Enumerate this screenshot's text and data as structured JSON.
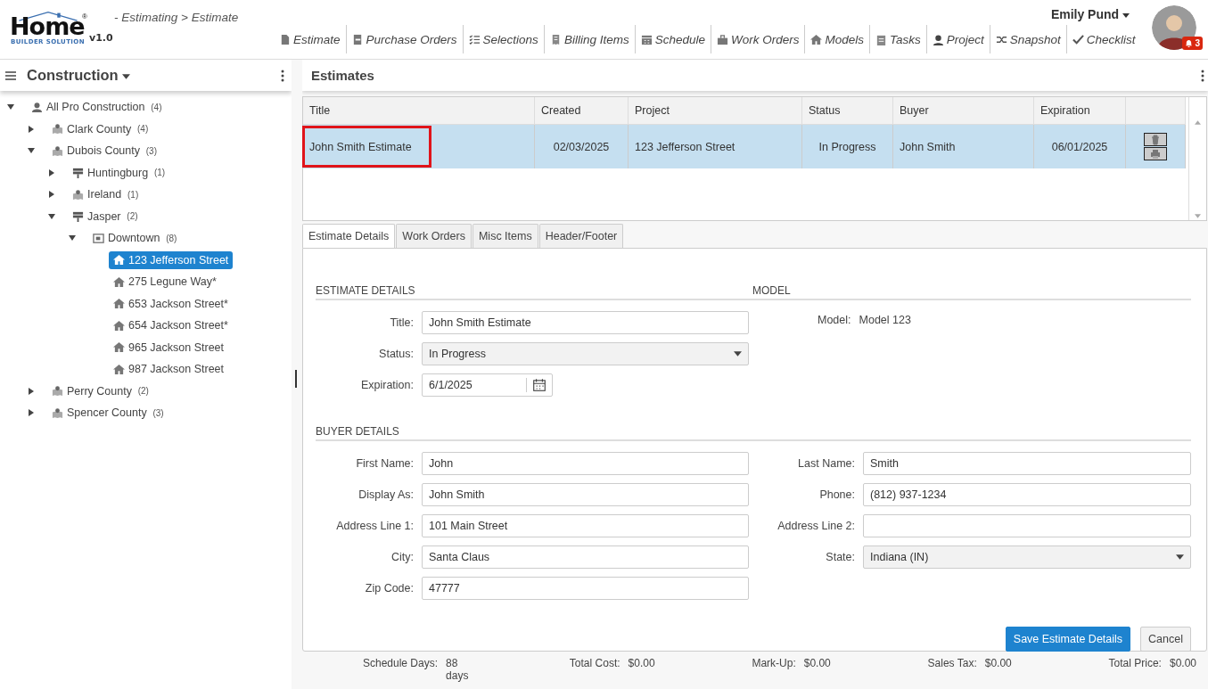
{
  "header": {
    "logo_word": "Home",
    "logo_sub": "BUILDER SOLUTION",
    "logo_mark": "®",
    "version": "v1.0",
    "breadcrumb": "- Estimating > Estimate",
    "user": "Emily Pund",
    "notifications": "3",
    "nav": [
      {
        "label": "Estimate",
        "kind": "doc"
      },
      {
        "label": "Purchase Orders",
        "kind": "printer"
      },
      {
        "label": "Selections",
        "kind": "list"
      },
      {
        "label": "Billing Items",
        "kind": "receipt"
      },
      {
        "label": "Schedule",
        "kind": "calendar"
      },
      {
        "label": "Work Orders",
        "kind": "toolbox"
      },
      {
        "label": "Models",
        "kind": "house"
      },
      {
        "label": "Tasks",
        "kind": "clipboard"
      },
      {
        "label": "Project",
        "kind": "worker"
      },
      {
        "label": "Snapshot",
        "kind": "shuffle"
      },
      {
        "label": "Checklist",
        "kind": "check"
      }
    ]
  },
  "sidebar": {
    "title": "Construction",
    "tree": [
      {
        "label": "All Pro Construction",
        "count": "(4)",
        "kind": "person",
        "expanded": true,
        "selected": false,
        "children": [
          {
            "label": "Clark County",
            "count": "(4)",
            "kind": "map",
            "expanded": false,
            "selected": false
          },
          {
            "label": "Dubois County",
            "count": "(3)",
            "kind": "map",
            "expanded": true,
            "selected": false,
            "children": [
              {
                "label": "Huntingburg",
                "count": "(1)",
                "kind": "sign",
                "expanded": false,
                "selected": false
              },
              {
                "label": "Ireland",
                "count": "(1)",
                "kind": "map",
                "expanded": false,
                "selected": false
              },
              {
                "label": "Jasper",
                "count": "(2)",
                "kind": "sign",
                "expanded": true,
                "selected": false,
                "children": [
                  {
                    "label": "Downtown",
                    "count": "(8)",
                    "kind": "district",
                    "expanded": true,
                    "selected": false,
                    "children": [
                      {
                        "label": "123 Jefferson Street",
                        "kind": "house",
                        "selected": true
                      },
                      {
                        "label": "275 Legune Way*",
                        "kind": "house",
                        "selected": false
                      },
                      {
                        "label": "653 Jackson Street*",
                        "kind": "house",
                        "selected": false
                      },
                      {
                        "label": "654 Jackson Street*",
                        "kind": "house",
                        "selected": false
                      },
                      {
                        "label": "965 Jackson Street",
                        "kind": "house",
                        "selected": false
                      },
                      {
                        "label": "987 Jackson Street",
                        "kind": "house",
                        "selected": false
                      }
                    ]
                  }
                ]
              }
            ]
          },
          {
            "label": "Perry County",
            "count": "(2)",
            "kind": "map",
            "expanded": false,
            "selected": false
          },
          {
            "label": "Spencer County",
            "count": "(3)",
            "kind": "map",
            "expanded": false,
            "selected": false
          }
        ]
      }
    ]
  },
  "main": {
    "title": "Estimates",
    "table": {
      "columns": [
        "Title",
        "Created",
        "Project",
        "Status",
        "Buyer",
        "Expiration"
      ],
      "rows": [
        {
          "cells": [
            "John Smith Estimate",
            "02/03/2025",
            "123 Jefferson Street",
            "In Progress",
            "John Smith",
            "06/01/2025"
          ],
          "selected": true,
          "title_outlined": true
        }
      ]
    },
    "tabs": [
      {
        "label": "Estimate Details",
        "selected": true
      },
      {
        "label": "Work Orders",
        "selected": false
      },
      {
        "label": "Misc Items",
        "selected": false
      },
      {
        "label": "Header/Footer",
        "selected": false
      }
    ],
    "estimate_details": {
      "heading": "ESTIMATE DETAILS",
      "fields": [
        {
          "label": "Title:",
          "value": "John Smith Estimate",
          "kind": "text"
        },
        {
          "label": "Status:",
          "value": "In Progress",
          "kind": "select"
        },
        {
          "label": "Expiration:",
          "value": "6/1/2025",
          "kind": "date"
        }
      ]
    },
    "model": {
      "heading": "MODEL",
      "label": "Model:",
      "value": "Model 123"
    },
    "buyer_details": {
      "heading": "BUYER DETAILS",
      "fields": [
        {
          "label": "First Name:",
          "value": "John",
          "kind": "text"
        },
        {
          "label": "Last Name:",
          "value": "Smith",
          "kind": "text"
        },
        {
          "label": "Display As:",
          "value": "John Smith",
          "kind": "text"
        },
        {
          "label": "Phone:",
          "value": "(812) 937-1234",
          "kind": "text"
        },
        {
          "label": "Address Line 1:",
          "value": "101 Main Street",
          "kind": "text"
        },
        {
          "label": "Address Line 2:",
          "kind": "text"
        },
        {
          "label": "City:",
          "value": "Santa Claus",
          "kind": "text"
        },
        {
          "label": "State:",
          "value": "Indiana (IN)",
          "kind": "select"
        },
        {
          "label": "Zip Code:",
          "value": "47777",
          "kind": "text"
        }
      ]
    },
    "buttons": [
      {
        "label": "Save Estimate Details",
        "kind": "primary"
      },
      {
        "label": "Cancel",
        "kind": "secondary"
      }
    ],
    "totals": [
      {
        "label": "Schedule Days:",
        "value": "88 days"
      },
      {
        "label": "Total Cost:",
        "value": "$0.00"
      },
      {
        "label": "Mark-Up:",
        "value": "$0.00"
      },
      {
        "label": "Sales Tax:",
        "value": "$0.00"
      },
      {
        "label": "Total Price:",
        "value": "$0.00"
      }
    ]
  }
}
